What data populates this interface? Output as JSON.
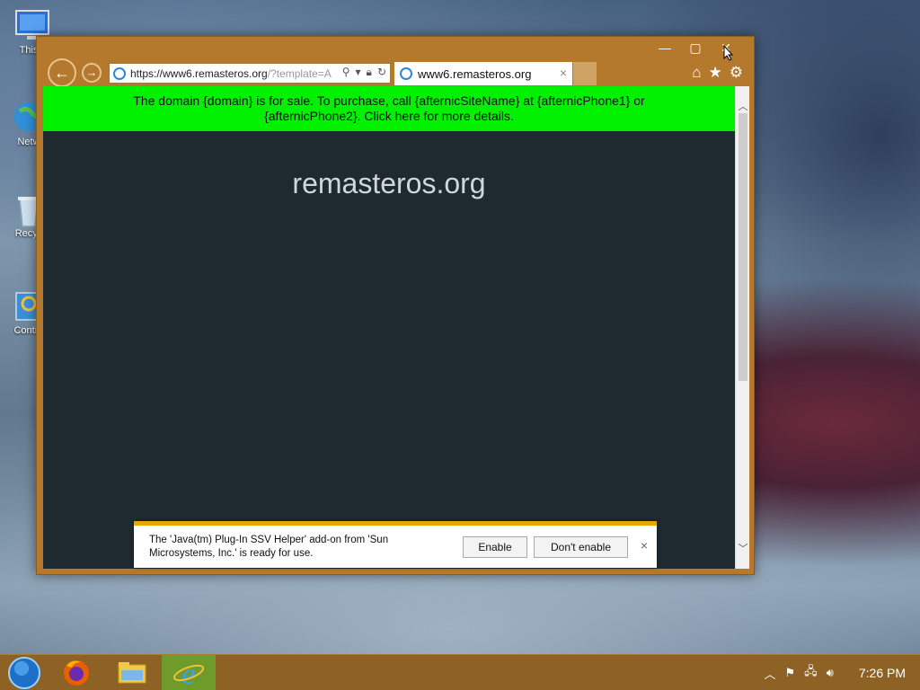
{
  "desktop": {
    "icons": [
      {
        "label": "This",
        "icon": "computer-icon"
      },
      {
        "label": "Netw",
        "icon": "network-icon"
      },
      {
        "label": "Recyc",
        "icon": "recycle-bin-icon"
      },
      {
        "label": "Contro",
        "icon": "control-panel-icon"
      }
    ]
  },
  "browser": {
    "address": {
      "host": "https://www6.remasteros.org",
      "rest": "/?template=A"
    },
    "tab": {
      "title": "www6.remasteros.org",
      "close": "×"
    },
    "window_controls": {
      "minimize": "—",
      "maximize": "▢",
      "close": "✕"
    },
    "toolbar": {
      "home": "⌂",
      "favorites": "★",
      "tools": "⚙"
    }
  },
  "page": {
    "banner_line1": "The domain {domain} is for sale. To purchase, call {afternicSiteName} at {afternicPhone1} or",
    "banner_line2": "{afternicPhone2}. Click here for more details.",
    "site_title": "remasteros.org",
    "banner_color": "#00f000",
    "background_color": "#1e2a30"
  },
  "notification": {
    "line1": "The 'Java(tm) Plug-In SSV Helper' add-on from 'Sun",
    "line2": "Microsystems, Inc.' is ready for use.",
    "enable_label": "Enable",
    "dont_enable_label": "Don't enable",
    "close": "×"
  },
  "taskbar": {
    "items": [
      "start-orb",
      "firefox",
      "file-explorer",
      "internet-explorer"
    ],
    "active": "internet-explorer",
    "clock": "7:26 PM",
    "accent_color": "#8e6224"
  }
}
